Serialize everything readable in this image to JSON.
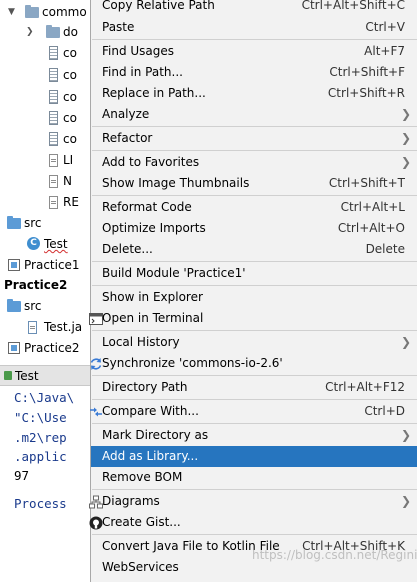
{
  "project_tree": {
    "root_label": "commo",
    "items": [
      {
        "label": "do",
        "kind": "folder"
      },
      {
        "label": "co",
        "kind": "jar"
      },
      {
        "label": "co",
        "kind": "jar"
      },
      {
        "label": "co",
        "kind": "jar"
      },
      {
        "label": "co",
        "kind": "jar"
      },
      {
        "label": "co",
        "kind": "jar"
      },
      {
        "label": "LI",
        "kind": "file"
      },
      {
        "label": "N",
        "kind": "file"
      },
      {
        "label": "RE",
        "kind": "file"
      }
    ],
    "src1_label": "src",
    "test1_label": "Test",
    "practice1_label": "Practice1",
    "practice2_label": "Practice2",
    "src2_label": "src",
    "test2_label": "Test.ja",
    "practice2_iml_label": "Practice2"
  },
  "run_panel": {
    "tab_label": "Test",
    "lines": [
      "C:\\Java\\",
      " \"C:\\Use",
      "  .m2\\rep",
      "  .applic",
      " 97",
      "",
      " Process"
    ]
  },
  "context_menu": {
    "items": [
      {
        "label": "Copy Relative Path",
        "shortcut": "Ctrl+Alt+Shift+C"
      },
      {
        "label": "Paste",
        "shortcut": "Ctrl+V"
      },
      {
        "label": "Find Usages",
        "shortcut": "Alt+F7"
      },
      {
        "label": "Find in Path...",
        "shortcut": "Ctrl+Shift+F"
      },
      {
        "label": "Replace in Path...",
        "shortcut": "Ctrl+Shift+R"
      },
      {
        "label": "Analyze",
        "shortcut": ""
      },
      {
        "label": "Refactor",
        "shortcut": ""
      },
      {
        "label": "Add to Favorites",
        "shortcut": ""
      },
      {
        "label": "Show Image Thumbnails",
        "shortcut": "Ctrl+Shift+T"
      },
      {
        "label": "Reformat Code",
        "shortcut": "Ctrl+Alt+L"
      },
      {
        "label": "Optimize Imports",
        "shortcut": "Ctrl+Alt+O"
      },
      {
        "label": "Delete...",
        "shortcut": "Delete"
      },
      {
        "label": "Build Module 'Practice1'",
        "shortcut": ""
      },
      {
        "label": "Show in Explorer",
        "shortcut": ""
      },
      {
        "label": "Open in Terminal",
        "shortcut": ""
      },
      {
        "label": "Local History",
        "shortcut": ""
      },
      {
        "label": "Synchronize 'commons-io-2.6'",
        "shortcut": ""
      },
      {
        "label": "Directory Path",
        "shortcut": "Ctrl+Alt+F12"
      },
      {
        "label": "Compare With...",
        "shortcut": "Ctrl+D"
      },
      {
        "label": "Mark Directory as",
        "shortcut": ""
      },
      {
        "label": "Add as Library...",
        "shortcut": ""
      },
      {
        "label": "Remove BOM",
        "shortcut": ""
      },
      {
        "label": "Diagrams",
        "shortcut": ""
      },
      {
        "label": "Create Gist...",
        "shortcut": ""
      },
      {
        "label": "Convert Java File to Kotlin File",
        "shortcut": "Ctrl+Alt+Shift+K"
      },
      {
        "label": "WebServices",
        "shortcut": ""
      }
    ],
    "highlight_color": "#2675bf"
  },
  "watermark": "https://blog.csdn.net/Reginic"
}
